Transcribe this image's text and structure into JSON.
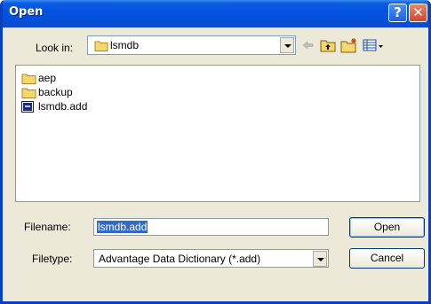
{
  "window": {
    "title": "Open",
    "help_glyph": "?",
    "close_glyph": "✕"
  },
  "lookin": {
    "label": "Look in:",
    "value": "lsmdb"
  },
  "toolbar": {
    "icons": [
      "back-arrow-icon",
      "up-folder-icon",
      "new-folder-icon",
      "view-menu-icon"
    ]
  },
  "files": [
    {
      "name": "aep",
      "type": "folder"
    },
    {
      "name": "backup",
      "type": "folder"
    },
    {
      "name": "lsmdb.add",
      "type": "file"
    }
  ],
  "filename": {
    "label": "Filename:",
    "value": "lsmdb.add"
  },
  "filetype": {
    "label": "Filetype:",
    "value": "Advantage Data Dictionary (*.add)"
  },
  "buttons": {
    "open": "Open",
    "cancel": "Cancel"
  },
  "colors": {
    "titlebar": "#0353e0",
    "selection": "#316ac5",
    "dialog_bg": "#ece9d8"
  }
}
